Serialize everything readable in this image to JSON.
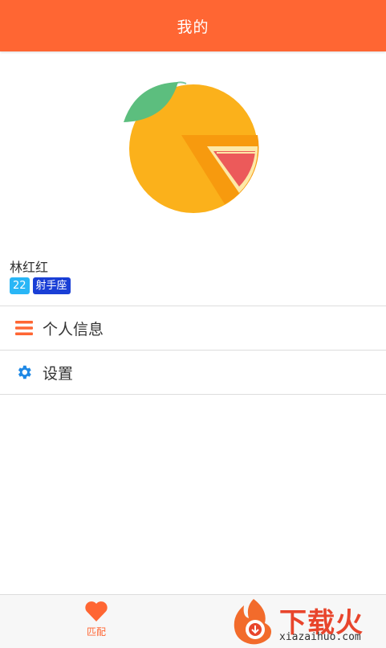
{
  "header": {
    "title": "我的"
  },
  "profile": {
    "avatar": "orange-fruit-avatar",
    "name": "林红红",
    "age": "22",
    "zodiac": "射手座"
  },
  "menu": [
    {
      "label": "个人信息",
      "icon": "list-icon",
      "icon_color": "#ff6633"
    },
    {
      "label": "设置",
      "icon": "gear-icon",
      "icon_color": "#1e88e5"
    }
  ],
  "tabbar": {
    "items": [
      {
        "label": "匹配",
        "icon": "heart-icon",
        "active": true
      }
    ]
  },
  "watermark": {
    "text": "下载火",
    "url": "xiazaihuo.com"
  },
  "colors": {
    "primary": "#ff6633",
    "age_tag": "#29b6f6",
    "zodiac_tag": "#1a3fd6"
  }
}
